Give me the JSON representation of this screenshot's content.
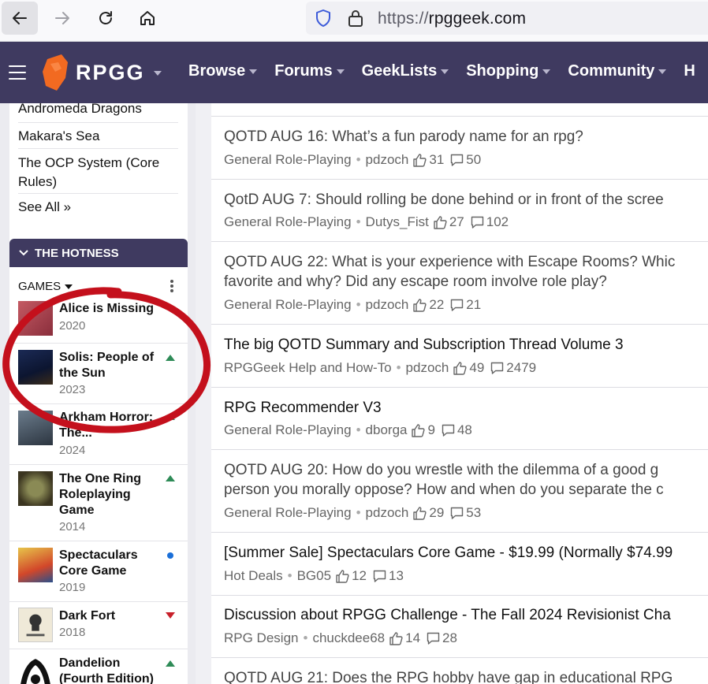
{
  "browser": {
    "url_scheme": "https://",
    "url_host": "rpggeek.com"
  },
  "header": {
    "logo": "RPGG",
    "nav": [
      "Browse",
      "Forums",
      "GeekLists",
      "Shopping",
      "Community",
      "H"
    ]
  },
  "sidebar": {
    "links": [
      "Andromeda Dragons",
      "Makara's Sea",
      "The OCP System (Core Rules)",
      "See All »"
    ],
    "hotness": {
      "title": "THE HOTNESS",
      "filter": "GAMES",
      "items": [
        {
          "title": "Alice is Missing",
          "year": "2020",
          "trend": "none"
        },
        {
          "title": "Solis: People of the Sun",
          "year": "2023",
          "trend": "up"
        },
        {
          "title": "Arkham Horror: The...",
          "year": "2024",
          "trend": "up"
        },
        {
          "title": "The One Ring Roleplaying Game",
          "year": "2014",
          "trend": "up"
        },
        {
          "title": "Spectaculars Core Game",
          "year": "2019",
          "trend": "new"
        },
        {
          "title": "Dark Fort",
          "year": "2018",
          "trend": "down"
        },
        {
          "title": "Dandelion (Fourth Edition)",
          "year": "",
          "trend": "up"
        }
      ]
    }
  },
  "threads": [
    {
      "title": "QOTD AUG 16: What’s a fun parody name for an rpg?",
      "forum": "General Role-Playing",
      "author": "pdzoch",
      "likes": "31",
      "comments": "50",
      "bold": false
    },
    {
      "title": "QotD AUG 7: Should rolling be done behind or in front of the scree",
      "forum": "General Role-Playing",
      "author": "Dutys_Fist",
      "likes": "27",
      "comments": "102",
      "bold": false
    },
    {
      "title": "QOTD AUG 22: What is your experience with Escape Rooms? Whic",
      "title2": "favorite and why? Did any escape room involve role play?",
      "forum": "General Role-Playing",
      "author": "pdzoch",
      "likes": "22",
      "comments": "21",
      "bold": false
    },
    {
      "title": "The big QOTD Summary and Subscription Thread Volume 3",
      "forum": "RPGGeek Help and How-To",
      "author": "pdzoch",
      "likes": "49",
      "comments": "2479",
      "bold": true
    },
    {
      "title": "RPG Recommender V3",
      "forum": "General Role-Playing",
      "author": "dborga",
      "likes": "9",
      "comments": "48",
      "bold": true
    },
    {
      "title": "QOTD AUG 20: How do you wrestle with the dilemma of a good g",
      "title2": "person you morally oppose? How and when do you separate the c",
      "forum": "General Role-Playing",
      "author": "pdzoch",
      "likes": "29",
      "comments": "53",
      "bold": false
    },
    {
      "title": "[Summer Sale] Spectaculars Core Game - $19.99 (Normally $74.99",
      "forum": "Hot Deals",
      "author": "BG05",
      "likes": "12",
      "comments": "13",
      "bold": true
    },
    {
      "title": "Discussion about RPGG Challenge - The Fall 2024 Revisionist Cha",
      "forum": "RPG Design",
      "author": "chuckdee68",
      "likes": "14",
      "comments": "28",
      "bold": true
    },
    {
      "title": "QOTD AUG 21: Does the RPG hobby have gap in educational RPG",
      "forum": "",
      "author": "",
      "likes": "",
      "comments": "",
      "bold": false
    }
  ],
  "colors": {
    "header_bg": "#3f3a60",
    "logo_orange": "#f26a21",
    "annotation": "#c4101c"
  }
}
